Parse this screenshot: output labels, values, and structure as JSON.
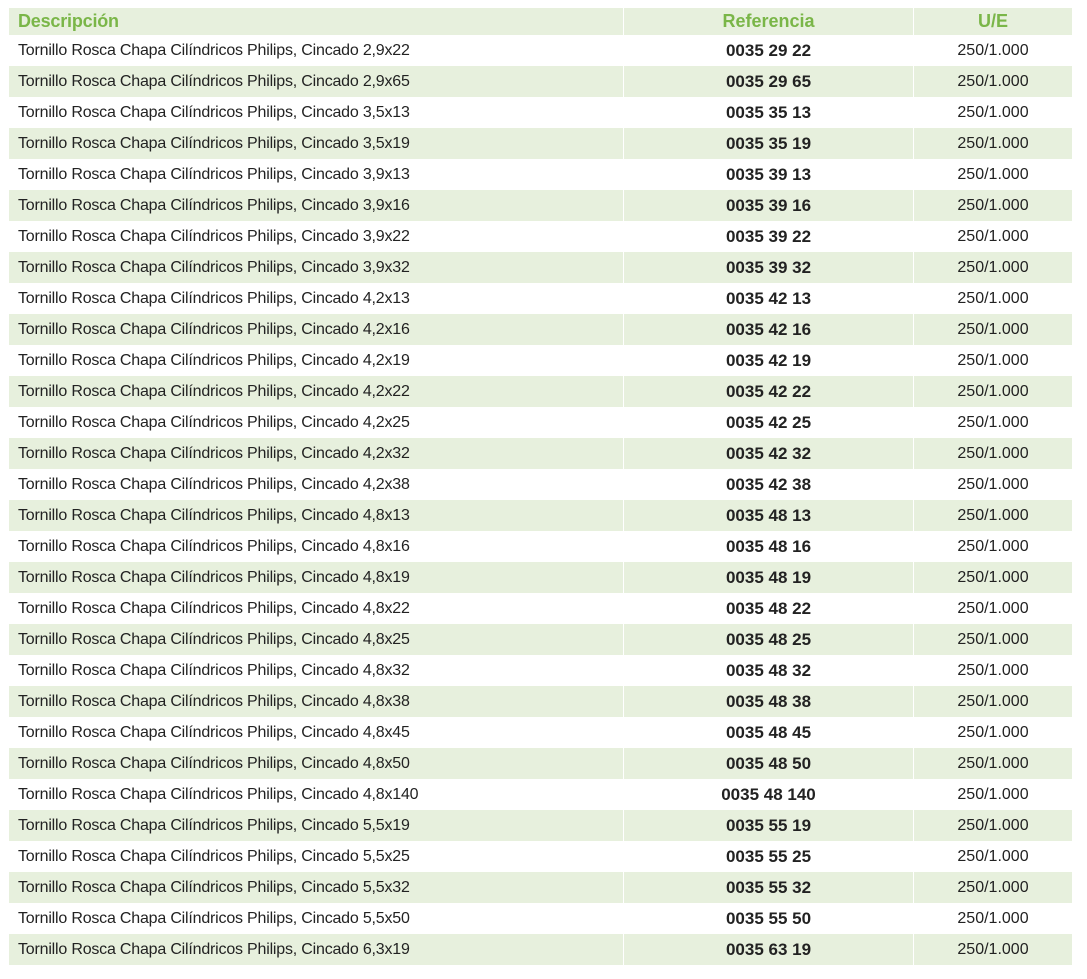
{
  "header": {
    "descripcion": "Descripción",
    "referencia": "Referencia",
    "ue": "U/E"
  },
  "colors": {
    "header_text": "#7ab648",
    "alt_row_bg": "#e7f0dd"
  },
  "rows": [
    {
      "desc": "Tornillo Rosca Chapa Cilíndricos Philips, Cincado 2,9x22",
      "ref": "0035 29 22",
      "ue": "250/1.000"
    },
    {
      "desc": "Tornillo Rosca Chapa Cilíndricos Philips, Cincado 2,9x65",
      "ref": "0035 29 65",
      "ue": "250/1.000"
    },
    {
      "desc": "Tornillo Rosca Chapa Cilíndricos Philips, Cincado 3,5x13",
      "ref": "0035 35 13",
      "ue": "250/1.000"
    },
    {
      "desc": "Tornillo Rosca Chapa Cilíndricos Philips, Cincado 3,5x19",
      "ref": "0035 35 19",
      "ue": "250/1.000"
    },
    {
      "desc": "Tornillo Rosca Chapa Cilíndricos Philips, Cincado 3,9x13",
      "ref": "0035 39 13",
      "ue": "250/1.000"
    },
    {
      "desc": "Tornillo Rosca Chapa Cilíndricos Philips, Cincado 3,9x16",
      "ref": "0035 39 16",
      "ue": "250/1.000"
    },
    {
      "desc": "Tornillo Rosca Chapa Cilíndricos Philips, Cincado 3,9x22",
      "ref": "0035 39 22",
      "ue": "250/1.000"
    },
    {
      "desc": "Tornillo Rosca Chapa Cilíndricos Philips, Cincado 3,9x32",
      "ref": "0035 39 32",
      "ue": "250/1.000"
    },
    {
      "desc": "Tornillo Rosca Chapa Cilíndricos Philips, Cincado 4,2x13",
      "ref": "0035 42 13",
      "ue": "250/1.000"
    },
    {
      "desc": "Tornillo Rosca Chapa Cilíndricos Philips, Cincado 4,2x16",
      "ref": "0035 42 16",
      "ue": "250/1.000"
    },
    {
      "desc": "Tornillo Rosca Chapa Cilíndricos Philips, Cincado 4,2x19",
      "ref": "0035 42 19",
      "ue": "250/1.000"
    },
    {
      "desc": "Tornillo Rosca Chapa Cilíndricos Philips, Cincado 4,2x22",
      "ref": "0035 42 22",
      "ue": "250/1.000"
    },
    {
      "desc": "Tornillo Rosca Chapa Cilíndricos Philips, Cincado 4,2x25",
      "ref": "0035 42 25",
      "ue": "250/1.000"
    },
    {
      "desc": "Tornillo Rosca Chapa Cilíndricos Philips, Cincado 4,2x32",
      "ref": "0035 42 32",
      "ue": "250/1.000"
    },
    {
      "desc": "Tornillo Rosca Chapa Cilíndricos Philips, Cincado 4,2x38",
      "ref": "0035 42 38",
      "ue": "250/1.000"
    },
    {
      "desc": "Tornillo Rosca Chapa Cilíndricos Philips, Cincado 4,8x13",
      "ref": "0035 48 13",
      "ue": "250/1.000"
    },
    {
      "desc": "Tornillo Rosca Chapa Cilíndricos Philips, Cincado 4,8x16",
      "ref": "0035 48 16",
      "ue": "250/1.000"
    },
    {
      "desc": "Tornillo Rosca Chapa Cilíndricos Philips, Cincado 4,8x19",
      "ref": "0035 48 19",
      "ue": "250/1.000"
    },
    {
      "desc": "Tornillo Rosca Chapa Cilíndricos Philips, Cincado 4,8x22",
      "ref": "0035 48 22",
      "ue": "250/1.000"
    },
    {
      "desc": "Tornillo Rosca Chapa Cilíndricos Philips, Cincado 4,8x25",
      "ref": "0035 48 25",
      "ue": "250/1.000"
    },
    {
      "desc": "Tornillo Rosca Chapa Cilíndricos Philips, Cincado 4,8x32",
      "ref": "0035 48 32",
      "ue": "250/1.000"
    },
    {
      "desc": "Tornillo Rosca Chapa Cilíndricos Philips, Cincado 4,8x38",
      "ref": "0035 48 38",
      "ue": "250/1.000"
    },
    {
      "desc": "Tornillo Rosca Chapa Cilíndricos Philips, Cincado 4,8x45",
      "ref": "0035 48 45",
      "ue": "250/1.000"
    },
    {
      "desc": "Tornillo Rosca Chapa Cilíndricos Philips, Cincado 4,8x50",
      "ref": "0035 48 50",
      "ue": "250/1.000"
    },
    {
      "desc": "Tornillo Rosca Chapa Cilíndricos Philips, Cincado 4,8x140",
      "ref": "0035 48 140",
      "ue": "250/1.000"
    },
    {
      "desc": "Tornillo Rosca Chapa Cilíndricos Philips, Cincado 5,5x19",
      "ref": "0035 55 19",
      "ue": "250/1.000"
    },
    {
      "desc": "Tornillo Rosca Chapa Cilíndricos Philips, Cincado 5,5x25",
      "ref": "0035 55 25",
      "ue": "250/1.000"
    },
    {
      "desc": "Tornillo Rosca Chapa Cilíndricos Philips, Cincado 5,5x32",
      "ref": "0035 55 32",
      "ue": "250/1.000"
    },
    {
      "desc": "Tornillo Rosca Chapa Cilíndricos Philips, Cincado 5,5x50",
      "ref": "0035 55 50",
      "ue": "250/1.000"
    },
    {
      "desc": "Tornillo Rosca Chapa Cilíndricos Philips, Cincado 6,3x19",
      "ref": "0035 63 19",
      "ue": "250/1.000"
    }
  ]
}
